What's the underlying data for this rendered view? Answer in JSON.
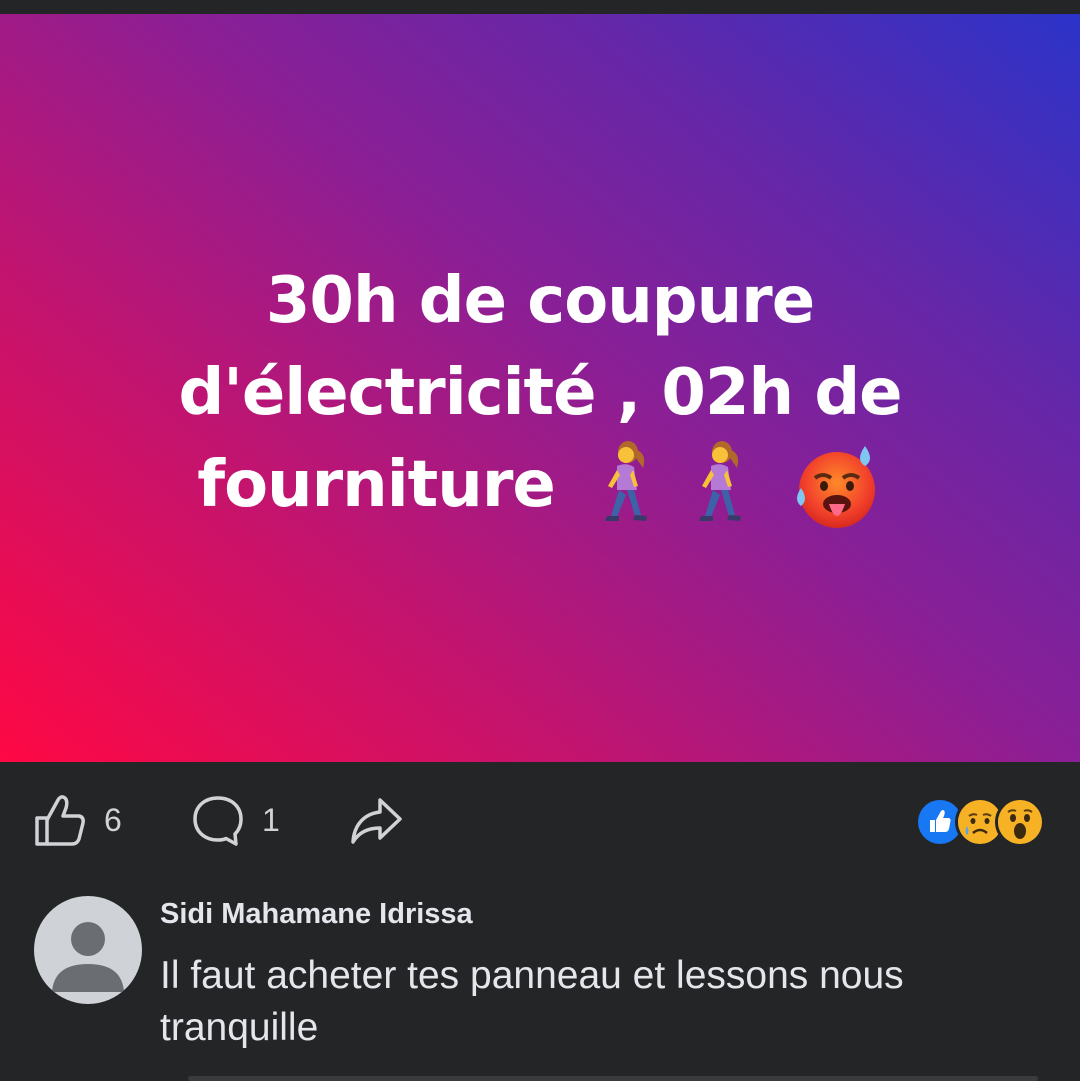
{
  "post": {
    "text_lines": [
      "30h de coupure",
      "d'électricité , 02h de",
      "fourniture"
    ],
    "emojis": [
      "woman-walking-icon",
      "woman-walking-icon",
      "hot-face-icon"
    ],
    "gradient": [
      "#ff0844",
      "#c2146f",
      "#8a1f96",
      "#6527a8",
      "#2b33c9"
    ]
  },
  "actions": {
    "like_count": "6",
    "comment_count": "1",
    "icons": [
      "thumbs-up-icon",
      "comment-bubble-icon",
      "share-arrow-icon"
    ]
  },
  "reactions": [
    "like-reaction-icon",
    "sad-reaction-icon",
    "wow-reaction-icon"
  ],
  "comment": {
    "author": "Sidi Mahamane Idrissa",
    "text": "Il faut acheter tes panneau et lessons nous tranquille"
  },
  "colors": {
    "background": "#242526",
    "text": "#e4e6eb",
    "like_blue": "#1877f2"
  }
}
